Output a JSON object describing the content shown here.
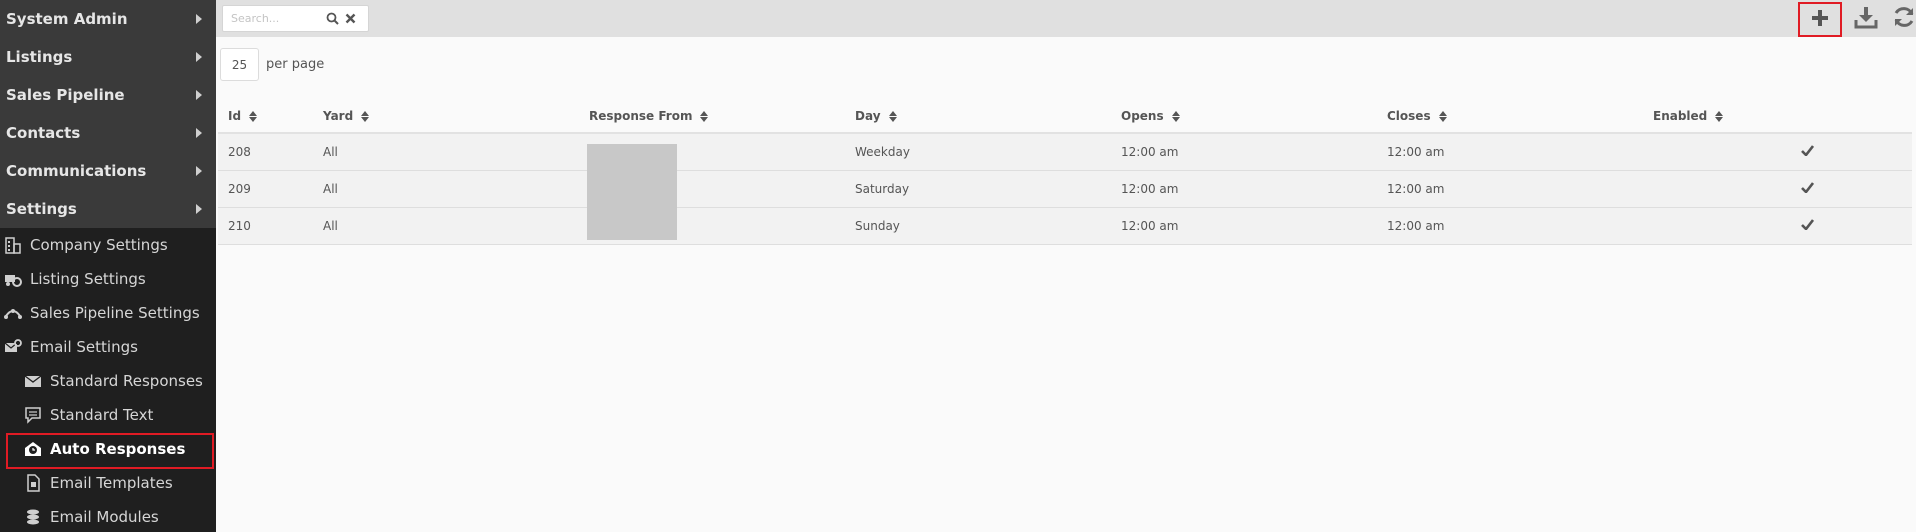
{
  "sidebar": {
    "menus": [
      {
        "label": "System Admin"
      },
      {
        "label": "Listings"
      },
      {
        "label": "Sales Pipeline"
      },
      {
        "label": "Contacts"
      },
      {
        "label": "Communications"
      },
      {
        "label": "Settings"
      }
    ],
    "settings_items": [
      {
        "label": "Company Settings",
        "icon": "building-icon"
      },
      {
        "label": "Listing Settings",
        "icon": "truck-gear-icon"
      },
      {
        "label": "Sales Pipeline Settings",
        "icon": "pipeline-icon"
      },
      {
        "label": "Email Settings",
        "icon": "envelope-gear-icon"
      }
    ],
    "email_items": [
      {
        "label": "Standard Responses",
        "icon": "envelope-icon"
      },
      {
        "label": "Standard Text",
        "icon": "comment-icon"
      },
      {
        "label": "Auto Responses",
        "icon": "envelope-clock-icon",
        "active": true
      },
      {
        "label": "Email Templates",
        "icon": "file-icon"
      },
      {
        "label": "Email Modules",
        "icon": "cubes-icon"
      }
    ]
  },
  "toolbar": {
    "search_placeholder": "Search...",
    "add_icon": "plus-icon",
    "download_icon": "download-icon",
    "refresh_icon": "refresh-icon"
  },
  "pagination": {
    "per_page_value": "25",
    "per_page_label": "per page"
  },
  "table": {
    "headers": {
      "id": "Id",
      "yard": "Yard",
      "response_from": "Response From",
      "day": "Day",
      "opens": "Opens",
      "closes": "Closes",
      "enabled": "Enabled"
    },
    "rows": [
      {
        "id": "208",
        "yard": "All",
        "response_from": "",
        "day": "Weekday",
        "opens": "12:00 am",
        "closes": "12:00 am",
        "enabled": true
      },
      {
        "id": "209",
        "yard": "All",
        "response_from": "",
        "day": "Saturday",
        "opens": "12:00 am",
        "closes": "12:00 am",
        "enabled": true
      },
      {
        "id": "210",
        "yard": "All",
        "response_from": "",
        "day": "Sunday",
        "opens": "12:00 am",
        "closes": "12:00 am",
        "enabled": true
      }
    ]
  },
  "colors": {
    "sidebar_bg": "#1f1f1f",
    "menu_bg": "#3a3a3a",
    "highlight": "#e01b24",
    "toolbar_bg": "#e0e0e0"
  }
}
